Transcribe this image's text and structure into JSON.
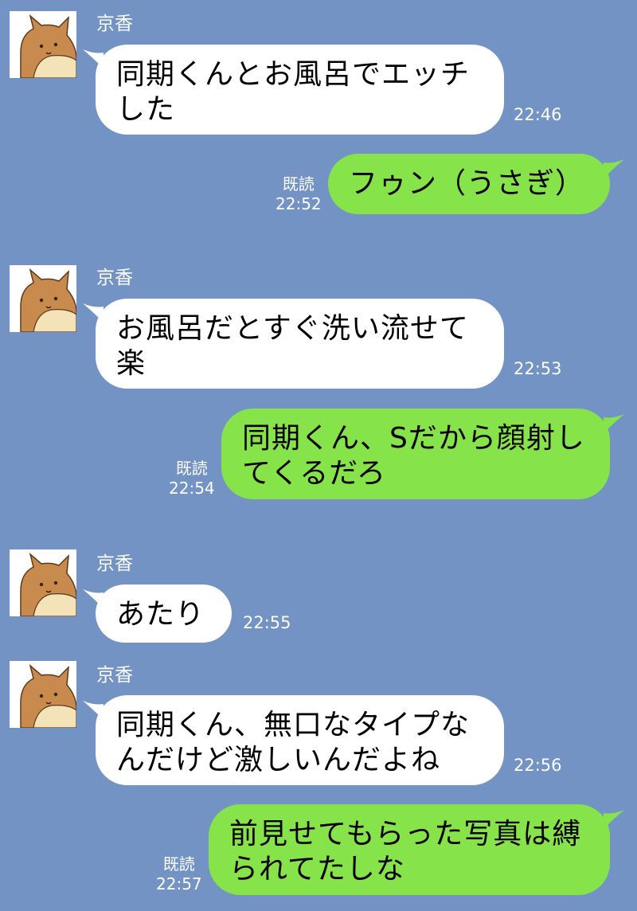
{
  "colors": {
    "background": "#7393c5",
    "incoming_bubble": "#ffffff",
    "outgoing_bubble": "#86e34a"
  },
  "contact": {
    "name": "京香",
    "avatar_icon": "shiba-dog-avatar-icon"
  },
  "read_label": "既読",
  "messages": [
    {
      "direction": "in",
      "sender": "京香",
      "text": "同期くんとお風呂でエッチ\nした",
      "time": "22:46"
    },
    {
      "direction": "out",
      "text": "フゥン（うさぎ）",
      "read": "既読",
      "time": "22:52"
    },
    {
      "direction": "in",
      "sender": "京香",
      "text": "お風呂だとすぐ洗い流せて\n楽",
      "time": "22:53"
    },
    {
      "direction": "out",
      "text": "同期くん、Sだから顔射し\nてくるだろ",
      "read": "既読",
      "time": "22:54"
    },
    {
      "direction": "in",
      "sender": "京香",
      "text": "あたり",
      "time": "22:55"
    },
    {
      "direction": "in",
      "sender": "京香",
      "text": "同期くん、無口なタイプな\nんだけど激しいんだよね",
      "time": "22:56"
    },
    {
      "direction": "out",
      "text": "前見せてもらった写真は縛\nられてたしな",
      "read": "既読",
      "time": "22:57"
    }
  ]
}
